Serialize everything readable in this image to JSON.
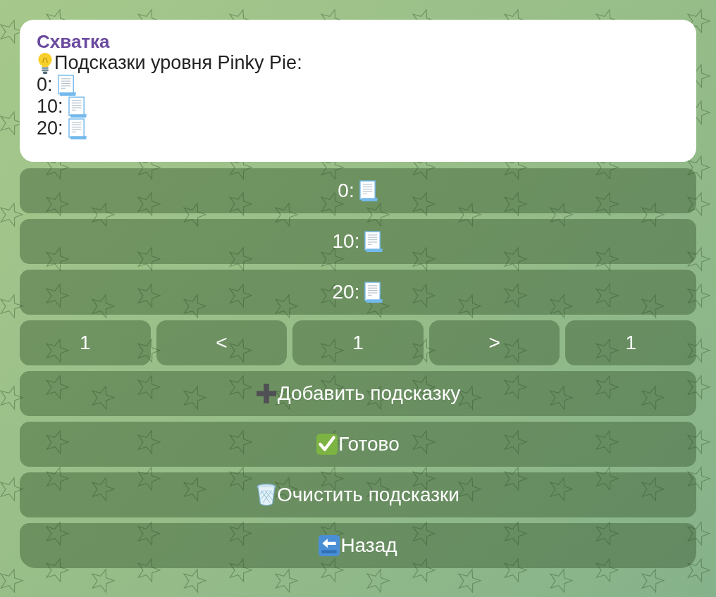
{
  "message": {
    "sender": "Схватка",
    "lines": [
      {
        "kind": "intro",
        "text": "Подсказки уровня Pinky Pie:"
      },
      {
        "kind": "hint",
        "text": "0:"
      },
      {
        "kind": "hint",
        "text": "10:"
      },
      {
        "kind": "hint",
        "text": "20:"
      }
    ]
  },
  "keyboard": {
    "rows": [
      {
        "buttons": [
          {
            "kind": "hint",
            "label": "0:"
          }
        ]
      },
      {
        "buttons": [
          {
            "kind": "hint",
            "label": "10:"
          }
        ]
      },
      {
        "buttons": [
          {
            "kind": "hint",
            "label": "20:"
          }
        ]
      },
      {
        "buttons": [
          {
            "kind": "plain",
            "label": "1"
          },
          {
            "kind": "plain",
            "label": "<"
          },
          {
            "kind": "plain",
            "label": "1"
          },
          {
            "kind": "plain",
            "label": ">"
          },
          {
            "kind": "plain",
            "label": "1"
          }
        ]
      },
      {
        "buttons": [
          {
            "kind": "add",
            "label": "Добавить подсказку"
          }
        ]
      },
      {
        "buttons": [
          {
            "kind": "done",
            "label": "Готово"
          }
        ]
      },
      {
        "buttons": [
          {
            "kind": "clear",
            "label": "Очистить подсказки"
          }
        ]
      },
      {
        "buttons": [
          {
            "kind": "back",
            "label": "Назад"
          }
        ]
      }
    ]
  }
}
